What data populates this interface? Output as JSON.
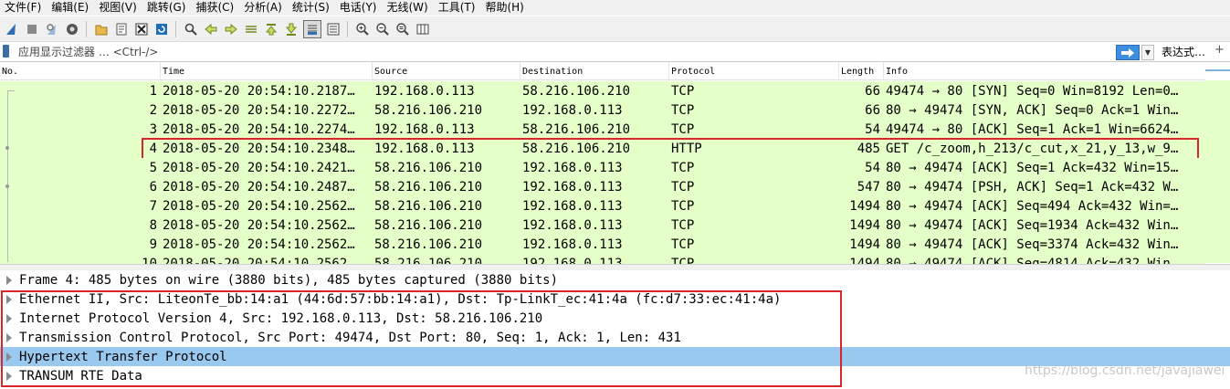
{
  "menu": {
    "items": [
      "文件(F)",
      "编辑(E)",
      "视图(V)",
      "跳转(G)",
      "捕获(C)",
      "分析(A)",
      "统计(S)",
      "电话(Y)",
      "无线(W)",
      "工具(T)",
      "帮助(H)"
    ]
  },
  "toolbar": {
    "icons": [
      "shark-fin-start-icon",
      "stop-square-icon",
      "restart-shark-icon",
      "capture-options-icon",
      "open-folder-icon",
      "save-file-icon",
      "close-file-icon",
      "reload-icon",
      "find-magnifier-icon",
      "back-arrow-icon",
      "forward-arrow-icon",
      "go-to-packet-icon",
      "first-packet-icon",
      "last-packet-icon",
      "autoscroll-icon",
      "colorize-icon",
      "zoom-in-icon",
      "zoom-out-icon",
      "zoom-normal-icon",
      "resize-columns-icon"
    ],
    "active_icon": "autoscroll-icon"
  },
  "filter": {
    "placeholder": "应用显示过滤器 … <Ctrl-/>",
    "expressions_label": "表达式…",
    "plus_label": "+"
  },
  "packet_list": {
    "columns": {
      "no": "No.",
      "time": "Time",
      "source": "Source",
      "destination": "Destination",
      "protocol": "Protocol",
      "length": "Length",
      "info": "Info"
    },
    "rows": [
      {
        "no": "1",
        "time": "2018-05-20 20:54:10.2187…",
        "source": "192.168.0.113",
        "destination": "58.216.106.210",
        "protocol": "TCP",
        "length": "66",
        "info": "49474 → 80 [SYN] Seq=0 Win=8192 Len=0…"
      },
      {
        "no": "2",
        "time": "2018-05-20 20:54:10.2272…",
        "source": "58.216.106.210",
        "destination": "192.168.0.113",
        "protocol": "TCP",
        "length": "66",
        "info": "80 → 49474 [SYN, ACK] Seq=0 Ack=1 Win…"
      },
      {
        "no": "3",
        "time": "2018-05-20 20:54:10.2274…",
        "source": "192.168.0.113",
        "destination": "58.216.106.210",
        "protocol": "TCP",
        "length": "54",
        "info": "49474 → 80 [ACK] Seq=1 Ack=1 Win=6624…"
      },
      {
        "no": "4",
        "time": "2018-05-20 20:54:10.2348…",
        "source": "192.168.0.113",
        "destination": "58.216.106.210",
        "protocol": "HTTP",
        "length": "485",
        "info": "GET /c_zoom,h_213/c_cut,x_21,y_13,w_9…"
      },
      {
        "no": "5",
        "time": "2018-05-20 20:54:10.2421…",
        "source": "58.216.106.210",
        "destination": "192.168.0.113",
        "protocol": "TCP",
        "length": "54",
        "info": "80 → 49474 [ACK] Seq=1 Ack=432 Win=15…"
      },
      {
        "no": "6",
        "time": "2018-05-20 20:54:10.2487…",
        "source": "58.216.106.210",
        "destination": "192.168.0.113",
        "protocol": "TCP",
        "length": "547",
        "info": "80 → 49474 [PSH, ACK] Seq=1 Ack=432 W…"
      },
      {
        "no": "7",
        "time": "2018-05-20 20:54:10.2562…",
        "source": "58.216.106.210",
        "destination": "192.168.0.113",
        "protocol": "TCP",
        "length": "1494",
        "info": "80 → 49474 [ACK] Seq=494 Ack=432 Win=…"
      },
      {
        "no": "8",
        "time": "2018-05-20 20:54:10.2562…",
        "source": "58.216.106.210",
        "destination": "192.168.0.113",
        "protocol": "TCP",
        "length": "1494",
        "info": "80 → 49474 [ACK] Seq=1934 Ack=432 Win…"
      },
      {
        "no": "9",
        "time": "2018-05-20 20:54:10.2562…",
        "source": "58.216.106.210",
        "destination": "192.168.0.113",
        "protocol": "TCP",
        "length": "1494",
        "info": "80 → 49474 [ACK] Seq=3374 Ack=432 Win…"
      },
      {
        "no": "10",
        "time": "2018-05-20 20:54:10.2562…",
        "source": "58.216.106.210",
        "destination": "192.168.0.113",
        "protocol": "TCP",
        "length": "1494",
        "info": "80 → 49474 [ACK] Seq=4814 Ack=432 Win…"
      }
    ],
    "selected_no": "4",
    "row_color": "#e4ffc7"
  },
  "details": {
    "rows": [
      {
        "text": "Frame 4: 485 bytes on wire (3880 bits), 485 bytes captured (3880 bits)"
      },
      {
        "text": "Ethernet II, Src: LiteonTe_bb:14:a1 (44:6d:57:bb:14:a1), Dst: Tp-LinkT_ec:41:4a (fc:d7:33:ec:41:4a)"
      },
      {
        "text": "Internet Protocol Version 4, Src: 192.168.0.113, Dst: 58.216.106.210"
      },
      {
        "text": "Transmission Control Protocol, Src Port: 49474, Dst Port: 80, Seq: 1, Ack: 1, Len: 431"
      },
      {
        "text": "Hypertext Transfer Protocol"
      },
      {
        "text": "TRANSUM RTE Data"
      }
    ],
    "selected_index": 4,
    "selected_color": "#99c9ef"
  },
  "annotation_color": "#d9262b",
  "watermark": "https://blog.csdn.net/javajiawei"
}
